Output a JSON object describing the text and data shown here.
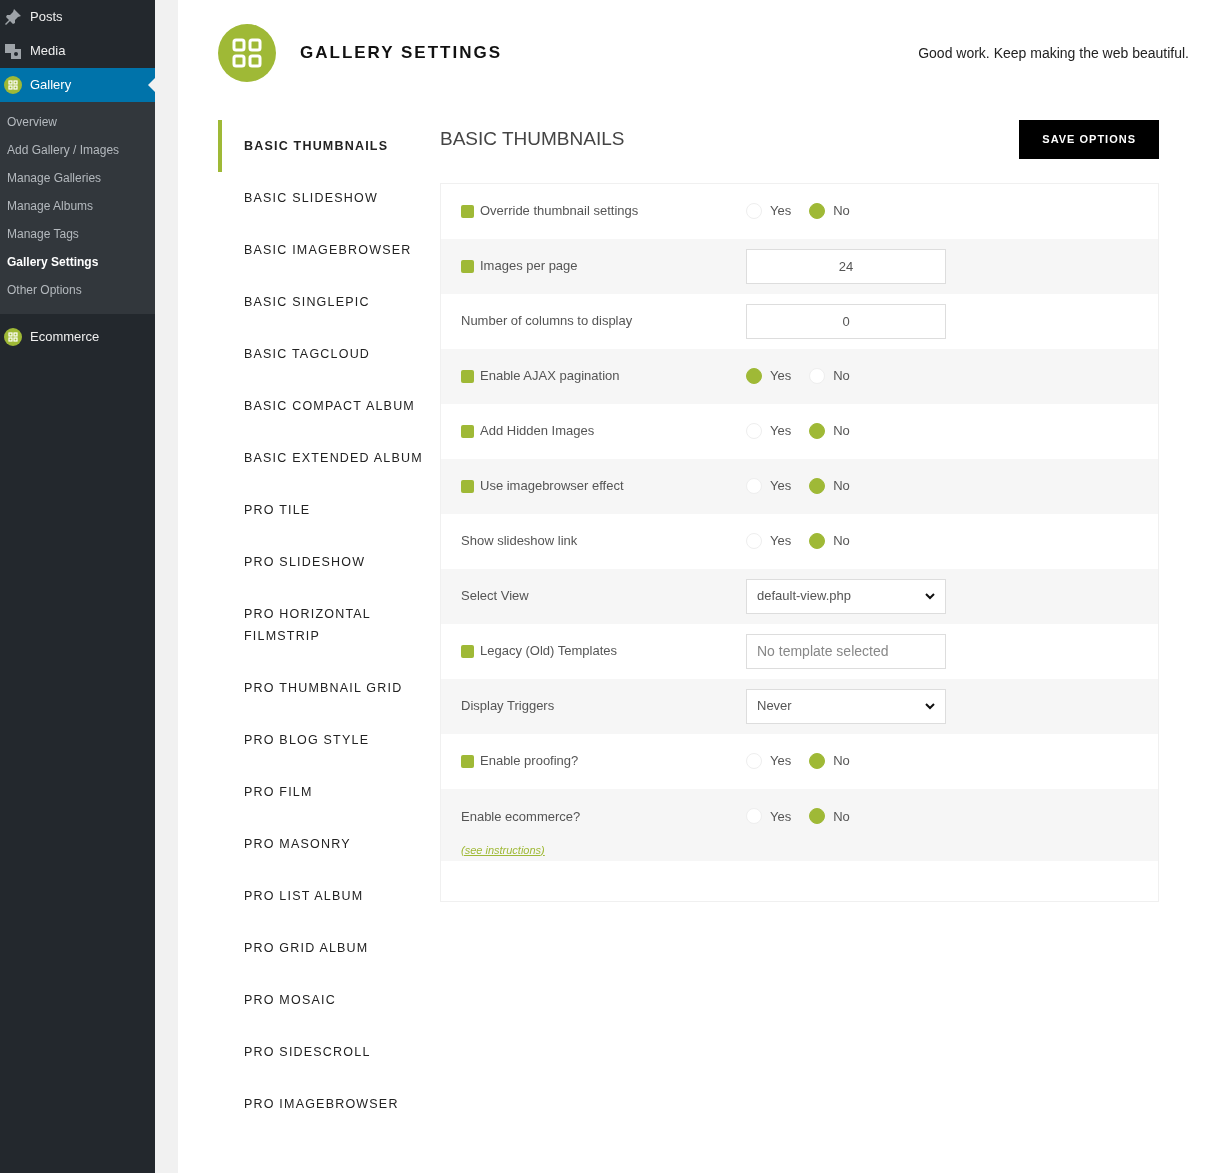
{
  "sidebar": {
    "items": [
      {
        "label": "Posts",
        "selected": false
      },
      {
        "label": "Media",
        "selected": false
      },
      {
        "label": "Gallery",
        "selected": true,
        "children": [
          {
            "label": "Overview",
            "selected": false
          },
          {
            "label": "Add Gallery / Images",
            "selected": false
          },
          {
            "label": "Manage Galleries",
            "selected": false
          },
          {
            "label": "Manage Albums",
            "selected": false
          },
          {
            "label": "Manage Tags",
            "selected": false
          },
          {
            "label": "Gallery Settings",
            "selected": true
          },
          {
            "label": "Other Options",
            "selected": false
          }
        ]
      },
      {
        "label": "Ecommerce",
        "selected": false
      }
    ]
  },
  "header": {
    "title": "GALLERY SETTINGS",
    "tagline": "Good work. Keep making the web beautiful."
  },
  "tabs": [
    {
      "label": "BASIC THUMBNAILS",
      "selected": true
    },
    {
      "label": "BASIC SLIDESHOW",
      "selected": false
    },
    {
      "label": "BASIC IMAGEBROWSER",
      "selected": false
    },
    {
      "label": "BASIC SINGLEPIC",
      "selected": false
    },
    {
      "label": "BASIC TAGCLOUD",
      "selected": false
    },
    {
      "label": "BASIC COMPACT ALBUM",
      "selected": false
    },
    {
      "label": "BASIC EXTENDED ALBUM",
      "selected": false
    },
    {
      "label": "PRO TILE",
      "selected": false
    },
    {
      "label": "PRO SLIDESHOW",
      "selected": false
    },
    {
      "label": "PRO HORIZONTAL FILMSTRIP",
      "selected": false
    },
    {
      "label": "PRO THUMBNAIL GRID",
      "selected": false
    },
    {
      "label": "PRO BLOG STYLE",
      "selected": false
    },
    {
      "label": "PRO FILM",
      "selected": false
    },
    {
      "label": "PRO MASONRY",
      "selected": false
    },
    {
      "label": "PRO LIST ALBUM",
      "selected": false
    },
    {
      "label": "PRO GRID ALBUM",
      "selected": false
    },
    {
      "label": "PRO MOSAIC",
      "selected": false
    },
    {
      "label": "PRO SIDESCROLL",
      "selected": false
    },
    {
      "label": "PRO IMAGEBROWSER",
      "selected": false
    }
  ],
  "panel": {
    "title": "BASIC THUMBNAILS",
    "save_button": "SAVE OPTIONS",
    "rows": [
      {
        "kind": "radio",
        "label": "Override thumbnail settings",
        "info": true,
        "options": [
          {
            "label": "Yes",
            "selected": false
          },
          {
            "label": "No",
            "selected": true
          }
        ]
      },
      {
        "kind": "number",
        "label": "Images per page",
        "info": true,
        "value": "24"
      },
      {
        "kind": "number",
        "label": "Number of columns to display",
        "info": false,
        "value": "0"
      },
      {
        "kind": "radio",
        "label": "Enable AJAX pagination",
        "info": true,
        "options": [
          {
            "label": "Yes",
            "selected": true
          },
          {
            "label": "No",
            "selected": false
          }
        ]
      },
      {
        "kind": "radio",
        "label": "Add Hidden Images",
        "info": true,
        "options": [
          {
            "label": "Yes",
            "selected": false
          },
          {
            "label": "No",
            "selected": true
          }
        ]
      },
      {
        "kind": "radio",
        "label": "Use imagebrowser effect",
        "info": true,
        "options": [
          {
            "label": "Yes",
            "selected": false
          },
          {
            "label": "No",
            "selected": true
          }
        ]
      },
      {
        "kind": "radio",
        "label": "Show slideshow link",
        "info": false,
        "options": [
          {
            "label": "Yes",
            "selected": false
          },
          {
            "label": "No",
            "selected": true
          }
        ]
      },
      {
        "kind": "select",
        "label": "Select View",
        "info": false,
        "value": "default-view.php"
      },
      {
        "kind": "text",
        "label": "Legacy (Old) Templates",
        "info": true,
        "placeholder": "No template selected"
      },
      {
        "kind": "select",
        "label": "Display Triggers",
        "info": false,
        "value": "Never"
      },
      {
        "kind": "radio",
        "label": "Enable proofing?",
        "info": true,
        "options": [
          {
            "label": "Yes",
            "selected": false
          },
          {
            "label": "No",
            "selected": true
          }
        ]
      },
      {
        "kind": "radio",
        "label": "Enable ecommerce?",
        "info": false,
        "link": "(see instructions)",
        "options": [
          {
            "label": "Yes",
            "selected": false
          },
          {
            "label": "No",
            "selected": true
          }
        ]
      }
    ]
  }
}
